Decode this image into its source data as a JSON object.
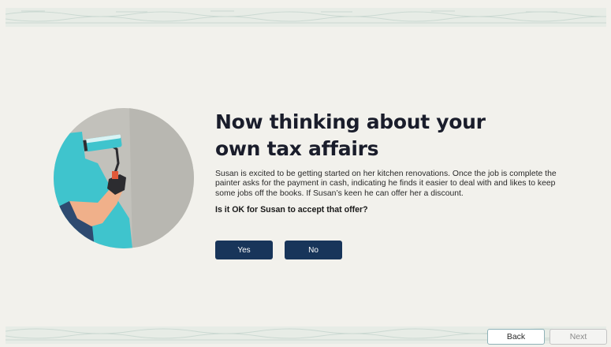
{
  "slide": {
    "title": "Now thinking about your own tax affairs",
    "body": "Susan is excited to be getting started on her kitchen renovations. Once the job is complete the painter asks for the payment in cash, indicating he finds it easier to deal with and likes to keep some jobs off the books. If Susan’s keen he can offer her a discount.",
    "question": "Is it OK for Susan to accept that offer?"
  },
  "answers": {
    "yes_label": "Yes",
    "no_label": "No"
  },
  "navigation": {
    "back_label": "Back",
    "next_label": "Next"
  },
  "colors": {
    "background": "#f2f1ec",
    "answer_button": "#18355a",
    "title_text": "#1a1d2b",
    "illustration_wall": "#c2c1bb",
    "illustration_paint": "#3fc4cd",
    "illustration_sleeve": "#2e4a70"
  }
}
